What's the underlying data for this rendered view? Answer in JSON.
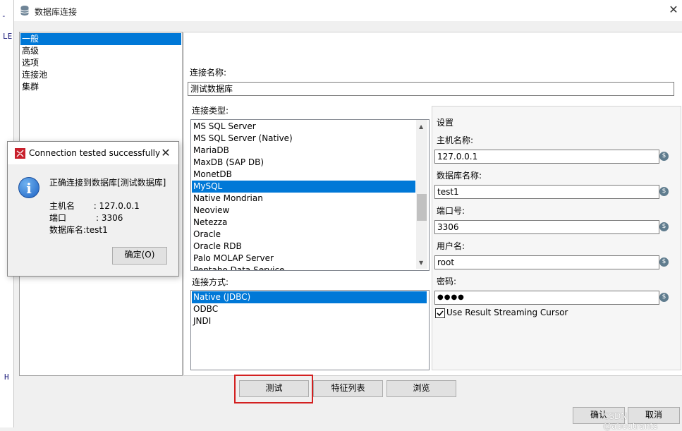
{
  "background": {
    "text_1": "LE",
    "text_2": "-",
    "text_3": "H"
  },
  "window": {
    "title": "数据库连接",
    "close": "✕"
  },
  "nav": {
    "items": [
      "一般",
      "高级",
      "选项",
      "连接池",
      "集群"
    ],
    "selected": 0
  },
  "connection_name": {
    "label": "连接名称:",
    "value": "测试数据库"
  },
  "connection_type": {
    "label": "连接类型:",
    "items": [
      "MS SQL Server",
      "MS SQL Server (Native)",
      "MariaDB",
      "MaxDB (SAP DB)",
      "MonetDB",
      "MySQL",
      "Native Mondrian",
      "Neoview",
      "Netezza",
      "Oracle",
      "Oracle RDB",
      "Palo MOLAP Server",
      "Pentaho Data Service"
    ],
    "selected": "MySQL"
  },
  "access": {
    "label": "连接方式:",
    "items": [
      "Native (JDBC)",
      "ODBC",
      "JNDI"
    ],
    "selected": "Native (JDBC)"
  },
  "settings": {
    "title": "设置",
    "host_label": "主机名称:",
    "host_value": "127.0.0.1",
    "db_label": "数据库名称:",
    "db_value": "test1",
    "port_label": "端口号:",
    "port_value": "3306",
    "user_label": "用户名:",
    "user_value": "root",
    "password_label": "密码:",
    "password_value": "●●●●",
    "streaming_label": "Use Result Streaming Cursor",
    "streaming_checked": true,
    "var_symbol": "$"
  },
  "buttons": {
    "test": "测试",
    "features": "特征列表",
    "browse": "浏览",
    "ok": "确认",
    "cancel": "取消"
  },
  "dialog": {
    "title": "Connection tested successfully",
    "message": "正确连接到数据库[测试数据库]",
    "host_line": "主机名       : 127.0.0.1",
    "port_line": "端口           : 3306",
    "db_line": "数据库名:test1",
    "ok": "确定(O)",
    "info_glyph": "i",
    "close": "✕"
  },
  "watermark": "CSDN @aboutrants",
  "colors": {
    "selection": "#0078d7",
    "highlight_border": "#d32020"
  }
}
